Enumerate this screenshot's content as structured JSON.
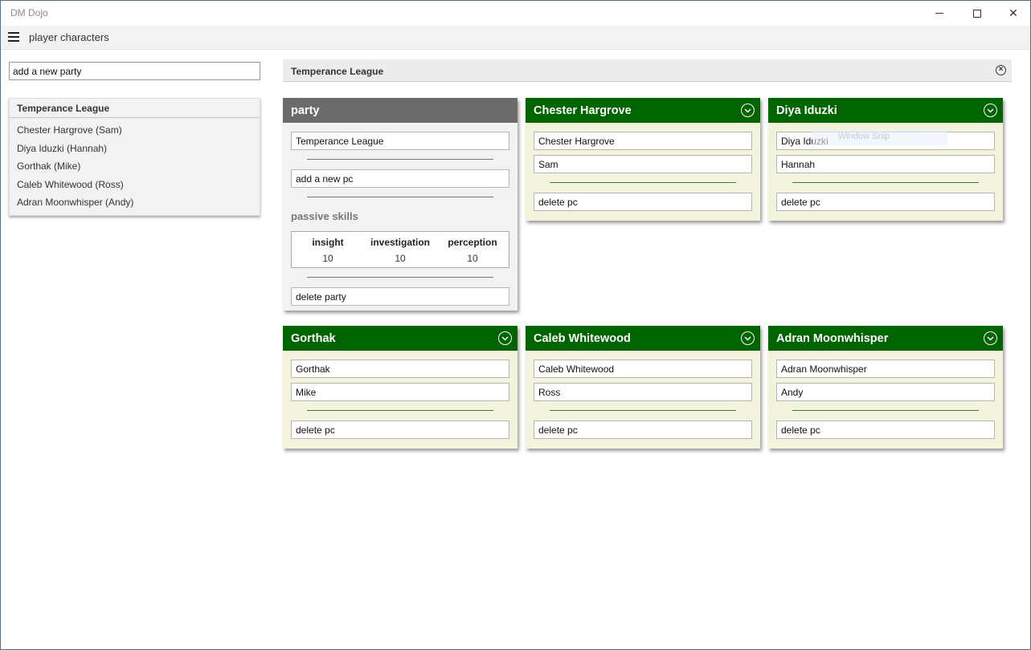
{
  "app": {
    "title": "DM Dojo"
  },
  "header": {
    "title": "player characters"
  },
  "window_controls": {
    "minimize": "minimize-icon",
    "maximize": "maximize-icon",
    "close": "✕"
  },
  "sidebar": {
    "new_party_value": "add a new party",
    "party_name": "Temperance League",
    "members": [
      "Chester Hargrove (Sam)",
      "Diya Iduzki (Hannah)",
      "Gorthak (Mike)",
      "Caleb Whitewood (Ross)",
      "Adran Moonwhisper (Andy)"
    ]
  },
  "main": {
    "party_title": "Temperance League",
    "party_card": {
      "heading": "party",
      "name_value": "Temperance League",
      "new_pc_value": "add a new pc",
      "skills_heading": "passive skills",
      "skills": [
        {
          "name": "insight",
          "value": "10"
        },
        {
          "name": "investigation",
          "value": "10"
        },
        {
          "name": "perception",
          "value": "10"
        }
      ],
      "delete_label": "delete party"
    },
    "pcs": [
      {
        "heading": "Chester Hargrove",
        "name": "Chester Hargrove",
        "player": "Sam",
        "delete_label": "delete pc"
      },
      {
        "heading": "Diya Iduzki",
        "name": "Diya Iduzki",
        "player": "Hannah",
        "delete_label": "delete pc"
      },
      {
        "heading": "Gorthak",
        "name": "Gorthak",
        "player": "Mike",
        "delete_label": "delete pc"
      },
      {
        "heading": "Caleb Whitewood",
        "name": "Caleb Whitewood",
        "player": "Ross",
        "delete_label": "delete pc"
      },
      {
        "heading": "Adran Moonwhisper",
        "name": "Adran Moonwhisper",
        "player": "Andy",
        "delete_label": "delete pc"
      }
    ],
    "overlay_text": "Window Snip"
  },
  "colors": {
    "card_header_green": "#006400",
    "card_body_cream": "#f4f4dc",
    "party_header_gray": "#6b6b6b"
  }
}
